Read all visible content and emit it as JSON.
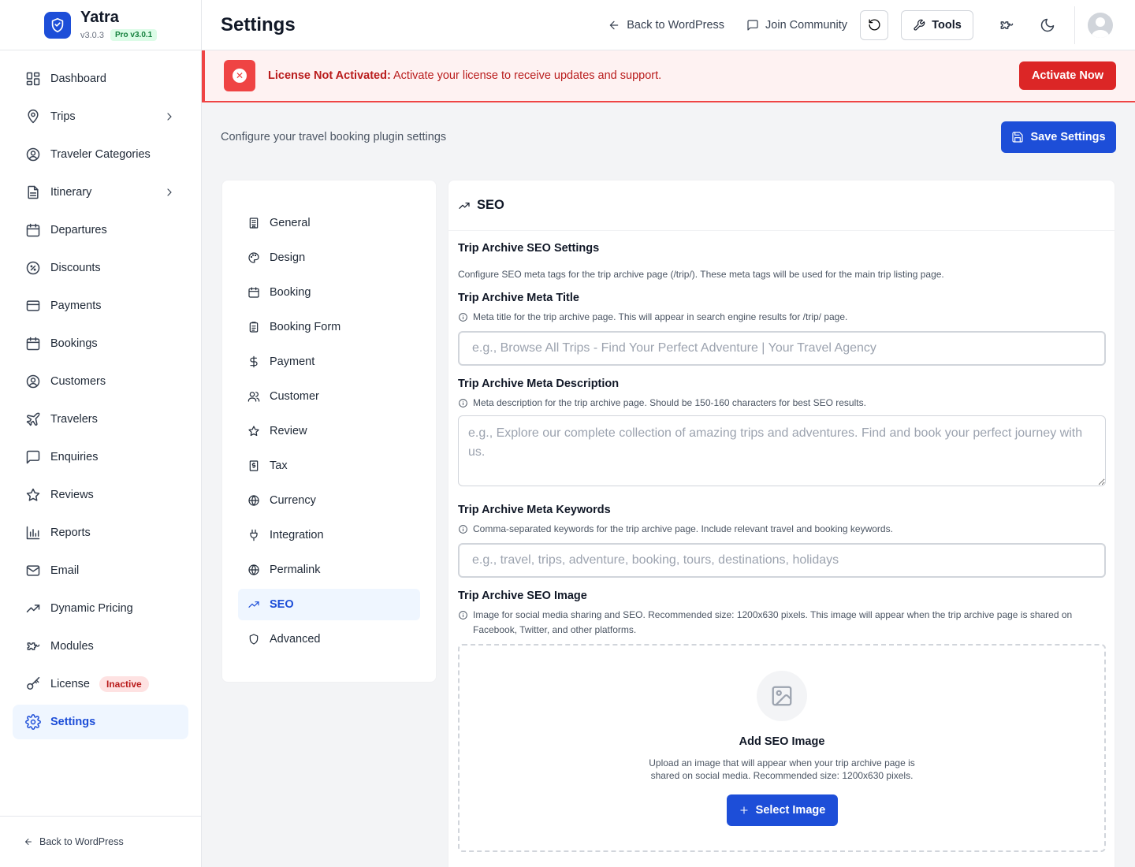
{
  "brand": {
    "name": "Yatra",
    "version": "v3.0.3",
    "pro_badge": "Pro v3.0.1"
  },
  "sidebar": {
    "items": [
      {
        "label": "Dashboard",
        "icon": "dashboard-icon"
      },
      {
        "label": "Trips",
        "icon": "map-pin-icon",
        "has_children": true
      },
      {
        "label": "Traveler Categories",
        "icon": "user-circle-icon"
      },
      {
        "label": "Itinerary",
        "icon": "document-icon",
        "has_children": true
      },
      {
        "label": "Departures",
        "icon": "calendar-icon"
      },
      {
        "label": "Discounts",
        "icon": "discount-icon"
      },
      {
        "label": "Payments",
        "icon": "credit-card-icon"
      },
      {
        "label": "Bookings",
        "icon": "calendar-icon"
      },
      {
        "label": "Customers",
        "icon": "user-circle-icon"
      },
      {
        "label": "Travelers",
        "icon": "plane-icon"
      },
      {
        "label": "Enquiries",
        "icon": "message-icon"
      },
      {
        "label": "Reviews",
        "icon": "star-icon"
      },
      {
        "label": "Reports",
        "icon": "bar-chart-icon"
      },
      {
        "label": "Email",
        "icon": "mail-icon"
      },
      {
        "label": "Dynamic Pricing",
        "icon": "trending-up-icon"
      },
      {
        "label": "Modules",
        "icon": "puzzle-icon"
      },
      {
        "label": "License",
        "icon": "key-icon",
        "badge": "Inactive"
      },
      {
        "label": "Settings",
        "icon": "gear-icon",
        "active": true
      }
    ],
    "footer_link": "Back to WordPress"
  },
  "header": {
    "title": "Settings",
    "back_link": "Back to WordPress",
    "community_link": "Join Community",
    "tools_label": "Tools"
  },
  "alert": {
    "title": "License Not Activated:",
    "message": "Activate your license to receive updates and support.",
    "button": "Activate Now"
  },
  "page": {
    "subtitle": "Configure your travel booking plugin settings",
    "save_button": "Save Settings"
  },
  "settings_nav": [
    {
      "label": "General",
      "icon": "building-icon"
    },
    {
      "label": "Design",
      "icon": "palette-icon"
    },
    {
      "label": "Booking",
      "icon": "calendar-icon"
    },
    {
      "label": "Booking Form",
      "icon": "clipboard-icon"
    },
    {
      "label": "Payment",
      "icon": "dollar-icon"
    },
    {
      "label": "Customer",
      "icon": "users-icon"
    },
    {
      "label": "Review",
      "icon": "star-icon"
    },
    {
      "label": "Tax",
      "icon": "receipt-icon"
    },
    {
      "label": "Currency",
      "icon": "globe-icon"
    },
    {
      "label": "Integration",
      "icon": "plug-icon"
    },
    {
      "label": "Permalink",
      "icon": "globe-icon"
    },
    {
      "label": "SEO",
      "icon": "trending-up-icon",
      "active": true
    },
    {
      "label": "Advanced",
      "icon": "shield-icon"
    }
  ],
  "seo": {
    "heading": "SEO",
    "section_title": "Trip Archive SEO Settings",
    "section_desc": "Configure SEO meta tags for the trip archive page (/trip/). These meta tags will be used for the main trip listing page.",
    "meta_title": {
      "label": "Trip Archive Meta Title",
      "hint": "Meta title for the trip archive page. This will appear in search engine results for /trip/ page.",
      "placeholder": "e.g., Browse All Trips - Find Your Perfect Adventure | Your Travel Agency",
      "value": ""
    },
    "meta_description": {
      "label": "Trip Archive Meta Description",
      "hint": "Meta description for the trip archive page. Should be 150-160 characters for best SEO results.",
      "placeholder": "e.g., Explore our complete collection of amazing trips and adventures. Find and book your perfect journey with us.",
      "value": ""
    },
    "meta_keywords": {
      "label": "Trip Archive Meta Keywords",
      "hint": "Comma-separated keywords for the trip archive page. Include relevant travel and booking keywords.",
      "placeholder": "e.g., travel, trips, adventure, booking, tours, destinations, holidays",
      "value": ""
    },
    "image": {
      "label": "Trip Archive SEO Image",
      "hint": "Image for social media sharing and SEO. Recommended size: 1200x630 pixels. This image will appear when the trip archive page is shared on Facebook, Twitter, and other platforms.",
      "dropzone_title": "Add SEO Image",
      "dropzone_desc": "Upload an image that will appear when your trip archive page is shared on social media. Recommended size: 1200x630 pixels.",
      "button": "Select Image"
    }
  },
  "colors": {
    "primary": "#1d4ed8",
    "danger": "#dc2626",
    "alert_bg": "#fef2f2",
    "success_badge": "#15803d"
  }
}
